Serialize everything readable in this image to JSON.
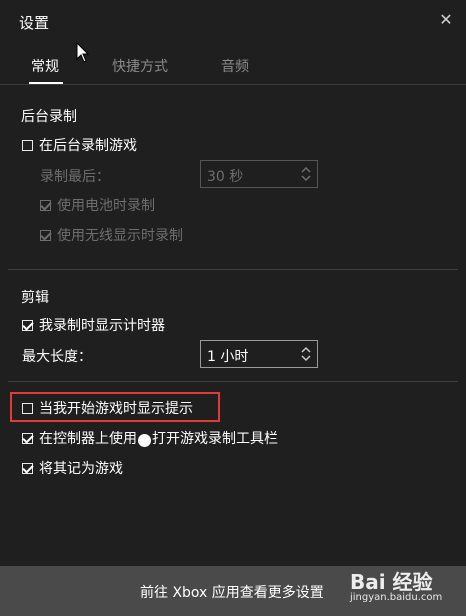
{
  "window": {
    "title": "设置",
    "close_icon": "close-icon"
  },
  "tabs": [
    {
      "label": "常规",
      "active": true
    },
    {
      "label": "快捷方式",
      "active": false
    },
    {
      "label": "音频",
      "active": false
    }
  ],
  "background_recording": {
    "heading": "后台录制",
    "record_in_background": {
      "label": "在后台录制游戏",
      "checked": false
    },
    "record_last_label": "录制最后：",
    "record_last_value": "30 秒",
    "record_on_battery": {
      "label": "使用电池时录制",
      "checked": true
    },
    "record_on_wireless_display": {
      "label": "使用无线显示时录制",
      "checked": true
    }
  },
  "clips": {
    "heading": "剪辑",
    "show_timer": {
      "label": "我录制时显示计时器",
      "checked": true
    },
    "max_length_label": "最大长度：",
    "max_length_value": "1 小时"
  },
  "general": {
    "show_tips": {
      "label": "当我开始游戏时显示提示",
      "checked": false
    },
    "open_gamebar_prefix": "在控制器上使用",
    "open_gamebar_suffix": "打开游戏录制工具栏",
    "open_gamebar_checked": true,
    "remember_as_game": {
      "label": "将其记为游戏",
      "checked": true
    }
  },
  "footer": {
    "link": "前往 Xbox 应用查看更多设置"
  },
  "watermark": {
    "text": "Bai 经验",
    "sub": "jingyan.baidu.com"
  },
  "colors": {
    "background": "#1f1f1f",
    "footer": "#4a4a4a",
    "highlight": "#e03a3a"
  }
}
